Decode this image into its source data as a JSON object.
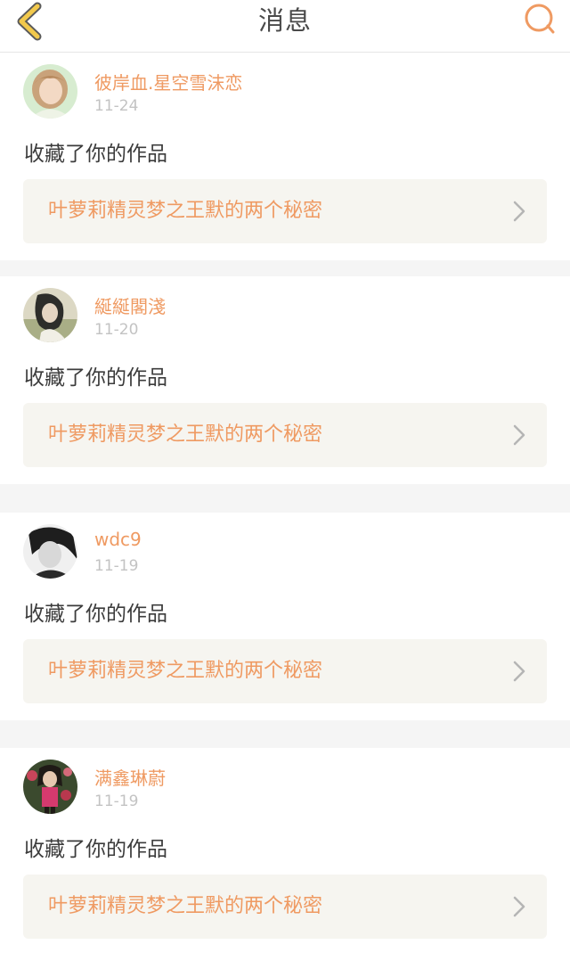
{
  "header": {
    "title": "消息"
  },
  "messages": [
    {
      "username": "彼岸血.星空雪沫恋",
      "date": "11-24",
      "action": "收藏了你的作品",
      "work_title": "叶萝莉精灵梦之王默的两个秘密"
    },
    {
      "username": "綖綖閣淺",
      "date": "11-20",
      "action": "收藏了你的作品",
      "work_title": "叶萝莉精灵梦之王默的两个秘密"
    },
    {
      "username": "wdc9",
      "date": "11-19",
      "action": "收藏了你的作品",
      "work_title": "叶萝莉精灵梦之王默的两个秘密"
    },
    {
      "username": "满鑫琳蔚",
      "date": "11-19",
      "action": "收藏了你的作品",
      "work_title": "叶萝莉精灵梦之王默的两个秘密"
    }
  ],
  "icons": {
    "back": "chevron-left-icon",
    "search": "search-icon",
    "work_arrow": "chevron-right-icon"
  },
  "colors": {
    "accent": "#ef9a62",
    "back_arrow_fill": "#f2c94c",
    "back_arrow_stroke": "#5a5a5a",
    "card_background": "#f6f5f0",
    "separator": "#f5f5f5",
    "date_text": "#c3c3c3",
    "action_text": "#3c3c3c"
  }
}
